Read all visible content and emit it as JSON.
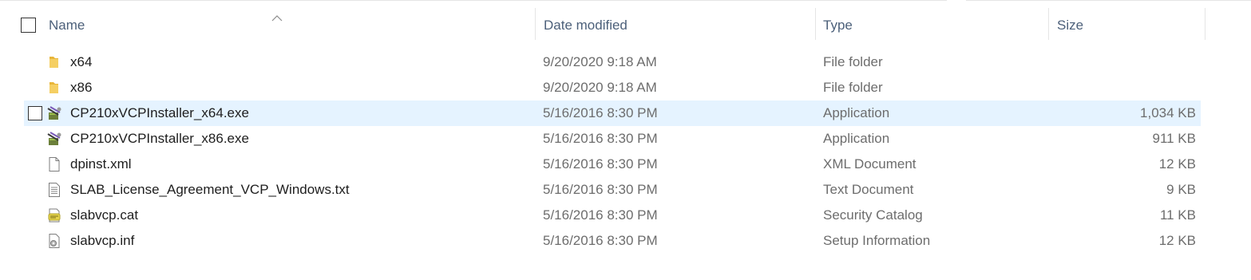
{
  "columns": {
    "name": "Name",
    "date_modified": "Date modified",
    "type": "Type",
    "size": "Size"
  },
  "files": [
    {
      "name": "x64",
      "date": "9/20/2020 9:18 AM",
      "type": "File folder",
      "size": "",
      "icon": "folder-icon"
    },
    {
      "name": "x86",
      "date": "9/20/2020 9:18 AM",
      "type": "File folder",
      "size": "",
      "icon": "folder-icon"
    },
    {
      "name": "CP210xVCPInstaller_x64.exe",
      "date": "5/16/2016 8:30 PM",
      "type": "Application",
      "size": "1,034 KB",
      "icon": "installer-icon",
      "selected": true
    },
    {
      "name": "CP210xVCPInstaller_x86.exe",
      "date": "5/16/2016 8:30 PM",
      "type": "Application",
      "size": "911 KB",
      "icon": "installer-icon"
    },
    {
      "name": "dpinst.xml",
      "date": "5/16/2016 8:30 PM",
      "type": "XML Document",
      "size": "12 KB",
      "icon": "xml-file-icon"
    },
    {
      "name": "SLAB_License_Agreement_VCP_Windows.txt",
      "date": "5/16/2016 8:30 PM",
      "type": "Text Document",
      "size": "9 KB",
      "icon": "text-file-icon"
    },
    {
      "name": "slabvcp.cat",
      "date": "5/16/2016 8:30 PM",
      "type": "Security Catalog",
      "size": "11 KB",
      "icon": "security-catalog-icon"
    },
    {
      "name": "slabvcp.inf",
      "date": "5/16/2016 8:30 PM",
      "type": "Setup Information",
      "size": "12 KB",
      "icon": "setup-info-icon"
    }
  ],
  "colors": {
    "selected_row": "#e5f3ff",
    "header_text": "#4c607a",
    "folder": "#f0c24a"
  }
}
